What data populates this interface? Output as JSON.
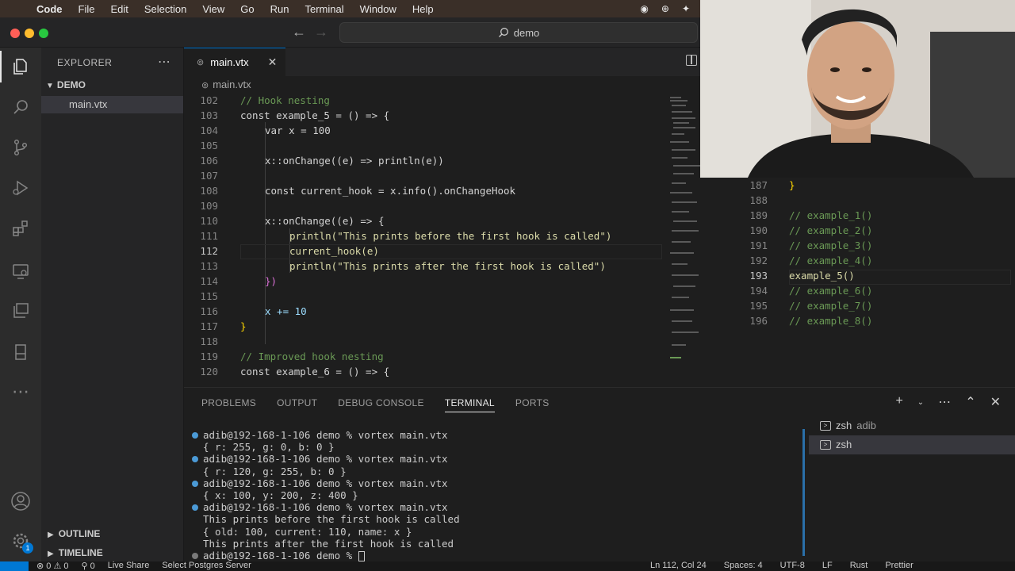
{
  "menubar": {
    "app_name": "Code",
    "items": [
      "File",
      "Edit",
      "Selection",
      "View",
      "Go",
      "Run",
      "Terminal",
      "Window",
      "Help"
    ]
  },
  "titlebar": {
    "search_text": "demo"
  },
  "sidebar": {
    "title": "EXPLORER",
    "folder": "DEMO",
    "file": "main.vtx",
    "outline": "OUTLINE",
    "timeline": "TIMELINE",
    "accounts_badge": "1"
  },
  "editor": {
    "tab_label": "main.vtx",
    "breadcrumb": "main.vtx",
    "lines": [
      {
        "n": "102",
        "t": "// Hook nesting"
      },
      {
        "n": "103",
        "t": "const example_5 = () => {"
      },
      {
        "n": "104",
        "t": "var x = 100"
      },
      {
        "n": "105",
        "t": ""
      },
      {
        "n": "106",
        "t": "x::onChange((e) => println(e))"
      },
      {
        "n": "107",
        "t": ""
      },
      {
        "n": "108",
        "t": "const current_hook = x.info().onChangeHook"
      },
      {
        "n": "109",
        "t": ""
      },
      {
        "n": "110",
        "t": "x::onChange((e) => {"
      },
      {
        "n": "111",
        "t": "println(\"This prints before the first hook is called\")"
      },
      {
        "n": "112",
        "t": "current_hook(e)"
      },
      {
        "n": "113",
        "t": "println(\"This prints after the first hook is called\")"
      },
      {
        "n": "114",
        "t": "})"
      },
      {
        "n": "115",
        "t": ""
      },
      {
        "n": "116",
        "t": "x += 10"
      },
      {
        "n": "117",
        "t": "}"
      },
      {
        "n": "118",
        "t": ""
      },
      {
        "n": "119",
        "t": "// Improved hook nesting"
      },
      {
        "n": "120",
        "t": "const example_6 = () => {"
      }
    ]
  },
  "editor2": {
    "lines": [
      {
        "n": "187",
        "t": "}"
      },
      {
        "n": "188",
        "t": ""
      },
      {
        "n": "189",
        "t": "// example_1()"
      },
      {
        "n": "190",
        "t": "// example_2()"
      },
      {
        "n": "191",
        "t": "// example_3()"
      },
      {
        "n": "192",
        "t": "// example_4()"
      },
      {
        "n": "193",
        "t": "example_5()"
      },
      {
        "n": "194",
        "t": "// example_6()"
      },
      {
        "n": "195",
        "t": "// example_7()"
      },
      {
        "n": "196",
        "t": "// example_8()"
      }
    ]
  },
  "panel": {
    "tabs": [
      "PROBLEMS",
      "OUTPUT",
      "DEBUG CONSOLE",
      "TERMINAL",
      "PORTS"
    ],
    "active_tab": "TERMINAL",
    "terminal_lines": [
      {
        "prompt": true,
        "t": "adib@192-168-1-106 demo % vortex main.vtx"
      },
      {
        "prompt": false,
        "t": "{ r: 255, g: 0, b: 0 }"
      },
      {
        "prompt": true,
        "t": "adib@192-168-1-106 demo % vortex main.vtx"
      },
      {
        "prompt": false,
        "t": "{ r: 120, g: 255, b: 0 }"
      },
      {
        "prompt": true,
        "t": "adib@192-168-1-106 demo % vortex main.vtx"
      },
      {
        "prompt": false,
        "t": "{ x: 100, y: 200, z: 400 }"
      },
      {
        "prompt": true,
        "t": "adib@192-168-1-106 demo % vortex main.vtx"
      },
      {
        "prompt": false,
        "t": "This prints before the first hook is called"
      },
      {
        "prompt": false,
        "t": "{ old: 100, current: 110, name: x }"
      },
      {
        "prompt": false,
        "t": "This prints after the first hook is called"
      },
      {
        "prompt": true,
        "t": "adib@192-168-1-106 demo % "
      }
    ],
    "terminals": [
      {
        "name": "zsh",
        "detail": "adib"
      },
      {
        "name": "zsh",
        "detail": ""
      }
    ]
  },
  "statusbar": {
    "problems": "⊗ 0 ⚠ 0",
    "ports": "⚲ 0",
    "live_share": "Live Share",
    "postgres": "Select Postgres Server",
    "position": "Ln 112, Col 24",
    "spaces": "Spaces: 4",
    "encoding": "UTF-8",
    "eol": "LF",
    "language": "Rust",
    "prettier": "Prettier"
  },
  "colors": {
    "accent": "#0078d4",
    "editor_bg": "#1e1e1e",
    "sidebar_bg": "#252526",
    "activity_bg": "#2c2c2c",
    "keyword": "#569cd6",
    "string": "#ce9178",
    "comment": "#6a9955",
    "function": "#dcdcaa"
  }
}
